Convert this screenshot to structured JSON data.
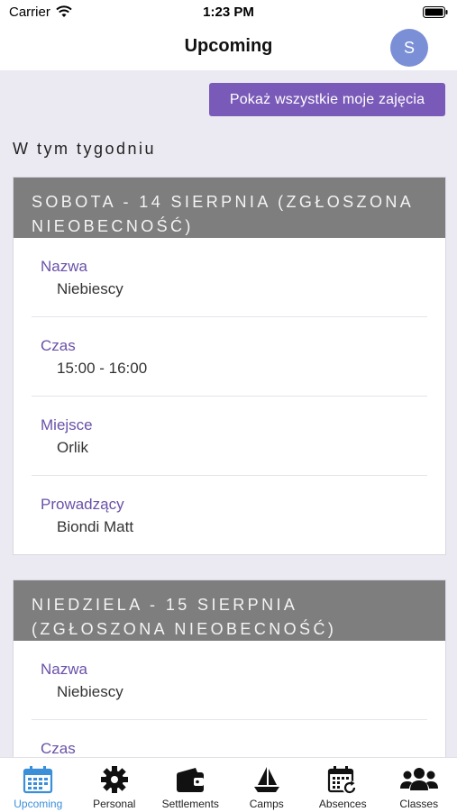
{
  "status_bar": {
    "carrier": "Carrier",
    "time": "1:23 PM"
  },
  "header": {
    "title": "Upcoming",
    "avatar_initial": "S"
  },
  "show_all_button": "Pokaż wszystkie moje zajęcia",
  "section_title": "W tym tygodniu",
  "cards": [
    {
      "header": "Sobota - 14 sierpnia (zgłoszona nieobecność)",
      "rows": [
        {
          "label": "Nazwa",
          "value": "Niebiescy"
        },
        {
          "label": "Czas",
          "value": "15:00 - 16:00"
        },
        {
          "label": "Miejsce",
          "value": "Orlik"
        },
        {
          "label": "Prowadzący",
          "value": "Biondi Matt"
        }
      ]
    },
    {
      "header": "Niedziela - 15 sierpnia (zgłoszona nieobecność)",
      "rows": [
        {
          "label": "Nazwa",
          "value": "Niebiescy"
        },
        {
          "label": "Czas",
          "value": ""
        }
      ]
    }
  ],
  "tabs": [
    {
      "label": "Upcoming",
      "icon": "calendar-icon",
      "active": true
    },
    {
      "label": "Personal",
      "icon": "gear-icon",
      "active": false
    },
    {
      "label": "Settlements",
      "icon": "wallet-icon",
      "active": false
    },
    {
      "label": "Camps",
      "icon": "sailboat-icon",
      "active": false
    },
    {
      "label": "Absences",
      "icon": "calendar-refresh-icon",
      "active": false
    },
    {
      "label": "Classes",
      "icon": "users-icon",
      "active": false
    }
  ],
  "colors": {
    "accent": "#7a5ab8",
    "label": "#6a51a8",
    "active_tab": "#3a8fd8",
    "card_header": "#7e7e7e"
  }
}
